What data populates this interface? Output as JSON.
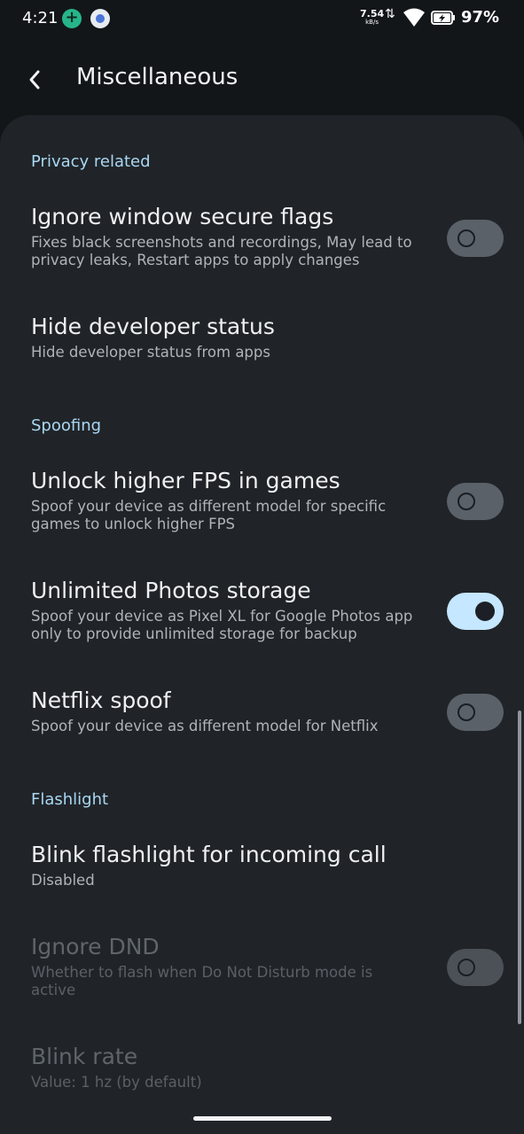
{
  "status_bar": {
    "time": "4:21",
    "net_speed_value": "7.54",
    "net_speed_unit": "kB/s",
    "network_arrows": "⇅",
    "battery_percent": "97%"
  },
  "app_bar": {
    "back_icon": "arrow-left-icon",
    "title": "Miscellaneous"
  },
  "sections": [
    {
      "header": "Privacy related",
      "items": [
        {
          "title": "Ignore window secure flags",
          "subtitle": "Fixes black screenshots and recordings, May lead to privacy leaks, Restart apps to apply changes",
          "toggle": "off"
        },
        {
          "title": "Hide developer status",
          "subtitle": "Hide developer status from apps"
        }
      ]
    },
    {
      "header": "Spoofing",
      "items": [
        {
          "title": "Unlock higher FPS in games",
          "subtitle": "Spoof your device as different model for specific games to unlock higher FPS",
          "toggle": "off"
        },
        {
          "title": "Unlimited Photos storage",
          "subtitle": "Spoof your device as Pixel XL for Google Photos app only to provide unlimited storage for backup",
          "toggle": "on"
        },
        {
          "title": "Netflix spoof",
          "subtitle": "Spoof your device as different model for Netflix",
          "toggle": "off"
        }
      ]
    },
    {
      "header": "Flashlight",
      "items": [
        {
          "title": "Blink flashlight for incoming call",
          "subtitle": "Disabled"
        },
        {
          "title": "Ignore DND",
          "subtitle": "Whether to flash when Do Not Disturb mode is active",
          "toggle": "off",
          "enabled": false
        },
        {
          "title": "Blink rate",
          "subtitle": "Value: 1 hz (by default)",
          "enabled": false
        }
      ]
    }
  ],
  "colors": {
    "background": "#131619",
    "panel": "#202428",
    "accent": "#a9d7f3",
    "toggle_on": "#c5e7ff"
  }
}
